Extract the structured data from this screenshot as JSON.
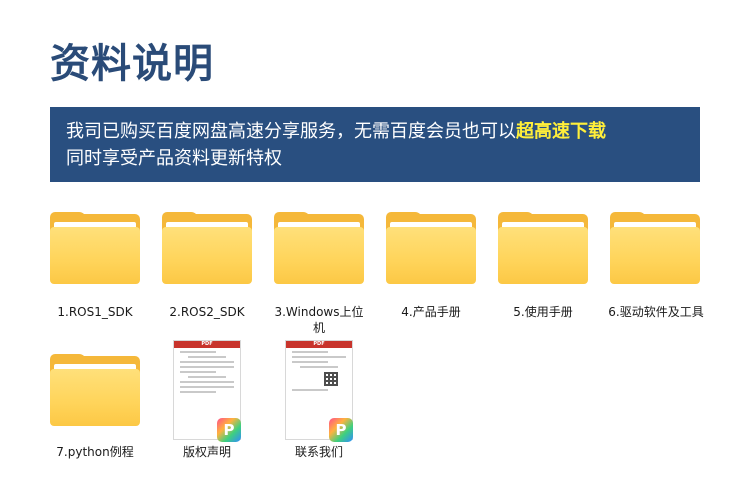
{
  "title": "资料说明",
  "banner": {
    "line1_text": "我司已购买百度网盘高速分享服务，无需百度会员也可以",
    "line1_highlight": "超高速下载",
    "line2_text": "同时享受产品资料更新特权",
    "highlight_color": "#ffef3a",
    "background_color": "#294f80"
  },
  "folders": [
    {
      "label": "1.ROS1_SDK",
      "icon": "folder-icon"
    },
    {
      "label": "2.ROS2_SDK",
      "icon": "folder-icon"
    },
    {
      "label": "3.Windows上位机",
      "icon": "folder-icon"
    },
    {
      "label": "4.产品手册",
      "icon": "folder-icon"
    },
    {
      "label": "5.使用手册",
      "icon": "folder-icon"
    },
    {
      "label": "6.驱动软件及工具",
      "icon": "folder-icon"
    },
    {
      "label": "7.python例程",
      "icon": "folder-icon"
    }
  ],
  "pdf_files": [
    {
      "label": "版权声明",
      "icon": "pdf-file-icon",
      "badge": "PDF"
    },
    {
      "label": "联系我们",
      "icon": "pdf-file-icon",
      "badge": "PDF"
    }
  ]
}
